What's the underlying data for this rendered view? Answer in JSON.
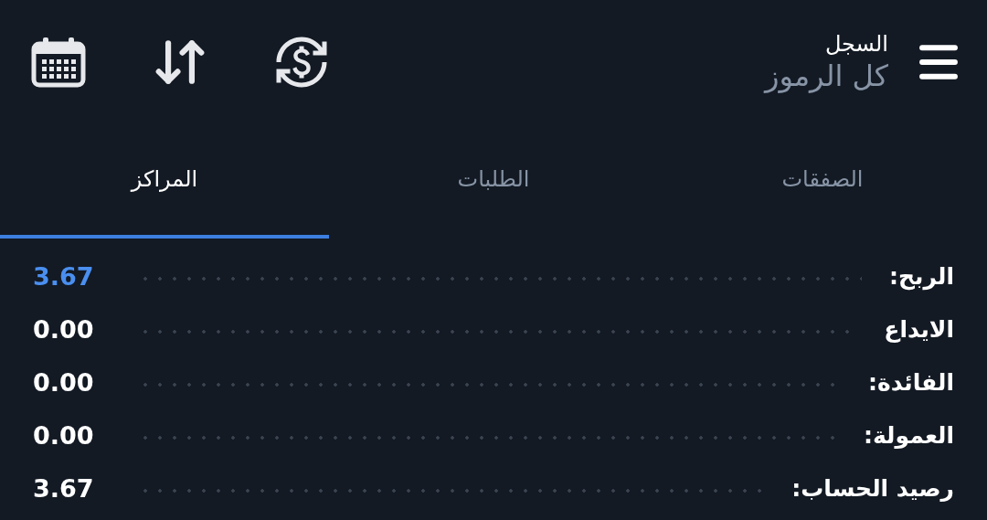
{
  "header": {
    "title": "السجل",
    "subtitle": "كل الرموز"
  },
  "tabs": [
    {
      "label": "الصفقات",
      "selected": false
    },
    {
      "label": "الطلبات",
      "selected": false
    },
    {
      "label": "المراكز",
      "selected": true
    }
  ],
  "summary": [
    {
      "label": "الربح:",
      "value": "3.67",
      "color": "#4a8ff0"
    },
    {
      "label": "الايداع",
      "value": "0.00",
      "color": "#ffffff"
    },
    {
      "label": "الفائدة:",
      "value": "0.00",
      "color": "#ffffff"
    },
    {
      "label": "العمولة:",
      "value": "0.00",
      "color": "#ffffff"
    },
    {
      "label": "رصيد الحساب:",
      "value": "3.67",
      "color": "#ffffff"
    }
  ]
}
